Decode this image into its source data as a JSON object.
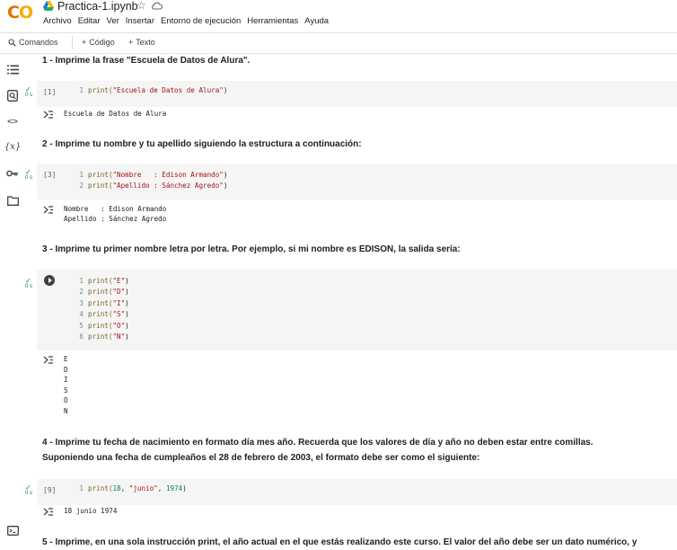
{
  "header": {
    "logo_left": "C",
    "logo_right": "O",
    "notebook_title": "Practica-1.ipynb",
    "star_glyph": "☆",
    "icons": [
      "drive-icon",
      "star-icon",
      "cloud-icon"
    ]
  },
  "menu": [
    "Archivo",
    "Editar",
    "Ver",
    "Insertar",
    "Entorno de ejecución",
    "Herramientas",
    "Ayuda"
  ],
  "toolbar": {
    "commands_label": "Comandos",
    "code_label": "Código",
    "text_label": "Texto",
    "plus": "+"
  },
  "sidebar": {
    "icons": [
      "toc-icon",
      "search-icon",
      "code-snippets-icon",
      "variables-icon",
      "secrets-key-icon",
      "folder-icon",
      "terminal-icon"
    ],
    "variables_glyph": "{x}",
    "code_glyph": "<>"
  },
  "cells": {
    "md1": "1 - Imprime la frase \"Escuela de Datos de Alura\".",
    "c1": {
      "exec": "[1]",
      "status": "0 s",
      "lines": [
        {
          "n": "1",
          "pre": "print(",
          "str": "\"Escuela de Datos de Alura\"",
          "post": ")"
        }
      ],
      "output": [
        "Escuela de Datos de Alura"
      ]
    },
    "md2": "2 - Imprime tu nombre y tu apellido siguiendo la estructura a continuación:",
    "c2": {
      "exec": "[3]",
      "status": "0 s",
      "lines": [
        {
          "n": "1",
          "pre": "print(",
          "str": "\"Nombre   : Edison Armando\"",
          "post": ")"
        },
        {
          "n": "2",
          "pre": "print(",
          "str": "\"Apellido : Sánchez Agredo\"",
          "post": ")"
        }
      ],
      "output": [
        "Nombre   : Edison Armando",
        "Apellido : Sánchez Agredo"
      ]
    },
    "md3": "3 - Imprime tu primer nombre letra por letra. Por ejemplo, si mi nombre es EDISON, la salida sería:",
    "c3": {
      "status": "0 s",
      "lines": [
        {
          "n": "1",
          "pre": "print(",
          "str": "\"E\"",
          "post": ")"
        },
        {
          "n": "2",
          "pre": "print(",
          "str": "\"D\"",
          "post": ")"
        },
        {
          "n": "3",
          "pre": "print(",
          "str": "\"I\"",
          "post": ")"
        },
        {
          "n": "4",
          "pre": "print(",
          "str": "\"S\"",
          "post": ")"
        },
        {
          "n": "5",
          "pre": "print(",
          "str": "\"O\"",
          "post": ")"
        },
        {
          "n": "6",
          "pre": "print(",
          "str": "\"N\"",
          "post": ")"
        }
      ],
      "output": [
        "E",
        "D",
        "I",
        "S",
        "O",
        "N"
      ]
    },
    "md4a": "4 - Imprime tu fecha de nacimiento en formato día mes año. Recuerda que los valores de día y año no deben estar entre comillas.",
    "md4b": "Suponiendo una fecha de cumpleaños el 28 de febrero de 2003, el formato debe ser como el siguiente:",
    "c4": {
      "exec": "[9]",
      "status": "0 s",
      "line": {
        "n": "1",
        "pre": "print(",
        "num1": "18",
        "sep1": ", ",
        "str": "\"junio\"",
        "sep2": ", ",
        "num2": "1974",
        "post": ")"
      },
      "output": [
        "18 junio 1974"
      ]
    },
    "md5": "5 - Imprime, en una sola instrucción print, el año actual en el que estás realizando este curso. El valor del año debe ser un dato numérico, y"
  },
  "colors": {
    "check": "#188038",
    "string": "#a31515",
    "number": "#098658",
    "function": "#795e26",
    "cell_bg": "#f5f5f5"
  }
}
